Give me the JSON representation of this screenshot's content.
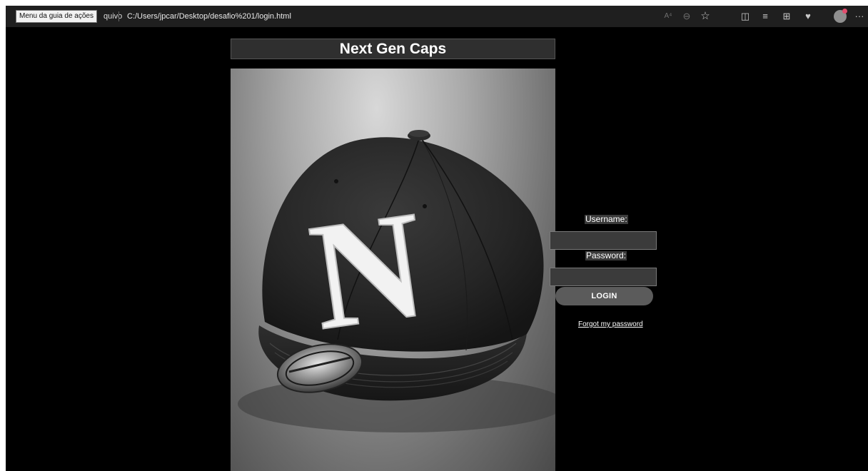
{
  "browser": {
    "tooltip": "Menu da guia de ações",
    "address_prefix": "quivo",
    "url": "C:/Users/jpcar/Desktop/desafio%201/login.html",
    "icons": {
      "read_aloud": "A⁴",
      "zoom": "⊖",
      "favorite": "☆",
      "split_screen": "◫",
      "favorites": "≡",
      "collections": "⊞",
      "performance": "♥",
      "more": "···"
    }
  },
  "page": {
    "title": "Next Gen Caps",
    "hero_letter": "N"
  },
  "login": {
    "username_label": "Username:",
    "username_value": "",
    "password_label": "Password:",
    "password_value": "",
    "login_button": "LOGIN",
    "forgot_link": "Forgot my password"
  }
}
